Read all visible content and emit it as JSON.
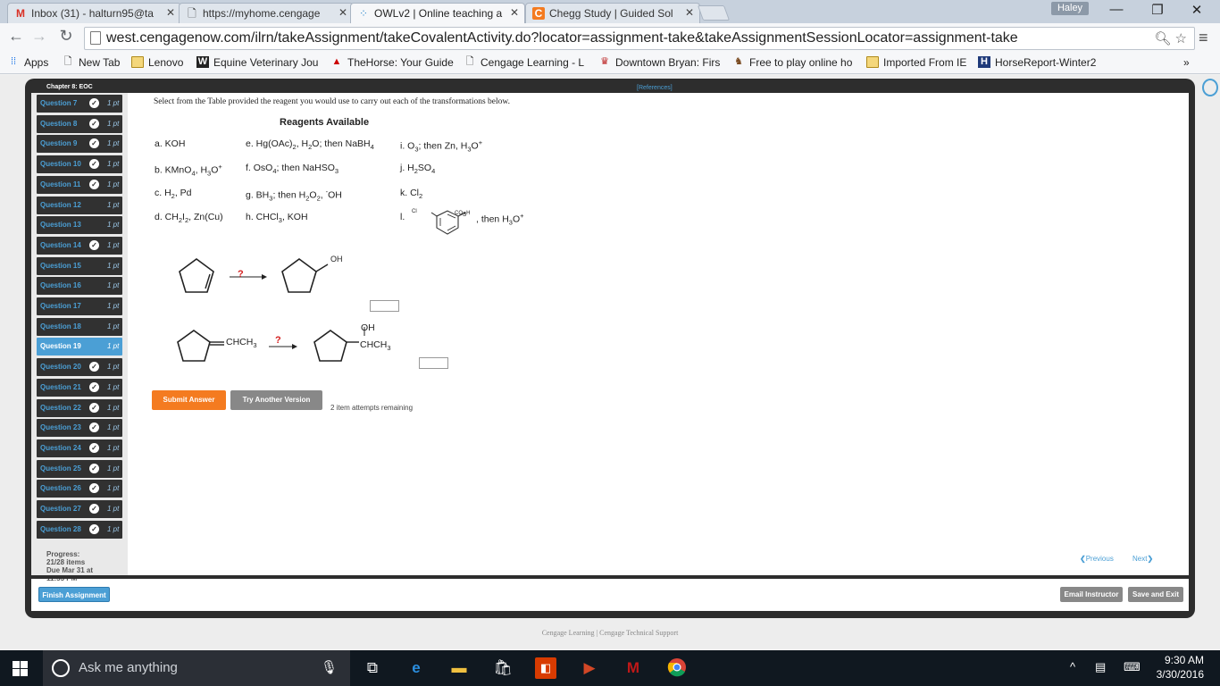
{
  "browser": {
    "tabs": [
      {
        "title": "Inbox (31) - halturn95@ta",
        "icon": "gmail-icon"
      },
      {
        "title": "https://myhome.cengage",
        "icon": "page-icon"
      },
      {
        "title": "OWLv2 | Online teaching a",
        "icon": "owl-icon",
        "active": true
      },
      {
        "title": "Chegg Study | Guided Sol",
        "icon": "chegg-icon"
      }
    ],
    "profile_name": "Haley",
    "url": "west.cengagenow.com/ilrn/takeAssignment/takeCovalentActivity.do?locator=assignment-take&takeAssignmentSessionLocator=assignment-take",
    "bookmarks": [
      {
        "label": "Apps",
        "icon": "apps-grid-icon"
      },
      {
        "label": "New Tab",
        "icon": "page-icon"
      },
      {
        "label": "Lenovo",
        "icon": "folder-icon"
      },
      {
        "label": "Equine Veterinary Jou",
        "icon": "w-logo-icon"
      },
      {
        "label": "TheHorse: Your Guide",
        "icon": "horse-logo-icon"
      },
      {
        "label": "Cengage Learning - L",
        "icon": "page-icon"
      },
      {
        "label": "Downtown Bryan: Firs",
        "icon": "downtown-logo-icon"
      },
      {
        "label": "Free to play online ho",
        "icon": "horse-game-icon"
      },
      {
        "label": "Imported From IE",
        "icon": "folder-icon"
      },
      {
        "label": "HorseReport-Winter2",
        "icon": "horsereport-icon"
      }
    ],
    "more_bookmarks": "»"
  },
  "owl": {
    "chapter_title": "Chapter 8: EOC",
    "references_link": "[References]",
    "questions": [
      {
        "label": "Question 7",
        "pts": "1 pt",
        "done": true
      },
      {
        "label": "Question 8",
        "pts": "1 pt",
        "done": true
      },
      {
        "label": "Question 9",
        "pts": "1 pt",
        "done": true
      },
      {
        "label": "Question 10",
        "pts": "1 pt",
        "done": true
      },
      {
        "label": "Question 11",
        "pts": "1 pt",
        "done": true
      },
      {
        "label": "Question 12",
        "pts": "1 pt",
        "done": false
      },
      {
        "label": "Question 13",
        "pts": "1 pt",
        "done": false
      },
      {
        "label": "Question 14",
        "pts": "1 pt",
        "done": true
      },
      {
        "label": "Question 15",
        "pts": "1 pt",
        "done": false
      },
      {
        "label": "Question 16",
        "pts": "1 pt",
        "done": false
      },
      {
        "label": "Question 17",
        "pts": "1 pt",
        "done": false
      },
      {
        "label": "Question 18",
        "pts": "1 pt",
        "done": false
      },
      {
        "label": "Question 19",
        "pts": "1 pt",
        "done": false,
        "active": true
      },
      {
        "label": "Question 20",
        "pts": "1 pt",
        "done": true
      },
      {
        "label": "Question 21",
        "pts": "1 pt",
        "done": true
      },
      {
        "label": "Question 22",
        "pts": "1 pt",
        "done": true
      },
      {
        "label": "Question 23",
        "pts": "1 pt",
        "done": true
      },
      {
        "label": "Question 24",
        "pts": "1 pt",
        "done": true
      },
      {
        "label": "Question 25",
        "pts": "1 pt",
        "done": true
      },
      {
        "label": "Question 26",
        "pts": "1 pt",
        "done": true
      },
      {
        "label": "Question 27",
        "pts": "1 pt",
        "done": true
      },
      {
        "label": "Question 28",
        "pts": "1 pt",
        "done": true
      }
    ],
    "progress_label": "Progress:",
    "progress_value": "21/28 items",
    "due_label": "Due Mar 31 at",
    "due_time": "11:55 PM",
    "instruction": "Select from the Table provided the reagent you would use to carry out each of the transformations below.",
    "reagents_title": "Reagents Available",
    "reagents_html": {
      "a": "a. KOH",
      "b": "b. KMnO<sub>4</sub>, H<sub>3</sub>O<sup>+</sup>",
      "c": "c. H<sub>2</sub>, Pd",
      "d": "d. CH<sub>2</sub>I<sub>2</sub>, Zn(Cu)",
      "e": "e. Hg(OAc)<sub>2</sub>, H<sub>2</sub>O; then NaBH<sub>4</sub>",
      "f": "f. OsO<sub>4</sub>; then NaHSO<sub>3</sub>",
      "g": "g. BH<sub>3</sub>; then H<sub>2</sub>O<sub>2</sub>, <sup>-</sup>OH",
      "h": "h. CHCl<sub>3</sub>, KOH",
      "i": "i. O<sub>3</sub>; then Zn, H<sub>3</sub>O<sup>+</sup>",
      "j": "j. H<sub>2</sub>SO<sub>4</sub>",
      "k": "k. Cl<sub>2</sub>",
      "l_prefix": "l.",
      "l_suffix": ", then H<sub>3</sub>O<sup>+</sup>"
    },
    "mcpba_labels": {
      "cl": "Cl",
      "co3h": "CO<sub>3</sub>H"
    },
    "reaction1": {
      "arrow_label": "?",
      "product_label": "OH"
    },
    "reaction2": {
      "reactant_label": "CHCH<sub>3</sub>",
      "arrow_label": "?",
      "product_oh": "OH",
      "product_label": "CHCH<sub>3</sub>"
    },
    "submit_label": "Submit Answer",
    "try_another_label": "Try Another Version",
    "attempts_text": "2 item attempts remaining",
    "previous_label": "Previous",
    "next_label": "Next",
    "finish_label": "Finish Assignment",
    "email_label": "Email Instructor",
    "save_exit_label": "Save and Exit",
    "colors": {
      "accent": "#4b9fd5",
      "submit": "#f47b20",
      "dark": "#2d2d2d",
      "question_mark": "#d42020"
    }
  },
  "footer_text": "Cengage Learning  |  Cengage Technical Support",
  "taskbar": {
    "search_placeholder": "Ask me anything",
    "time": "9:30 AM",
    "date": "3/30/2016",
    "apps": [
      "task-view-icon",
      "edge-icon",
      "file-explorer-icon",
      "store-icon",
      "office-icon",
      "powerpoint-icon",
      "mcafee-icon",
      "chrome-icon"
    ]
  }
}
